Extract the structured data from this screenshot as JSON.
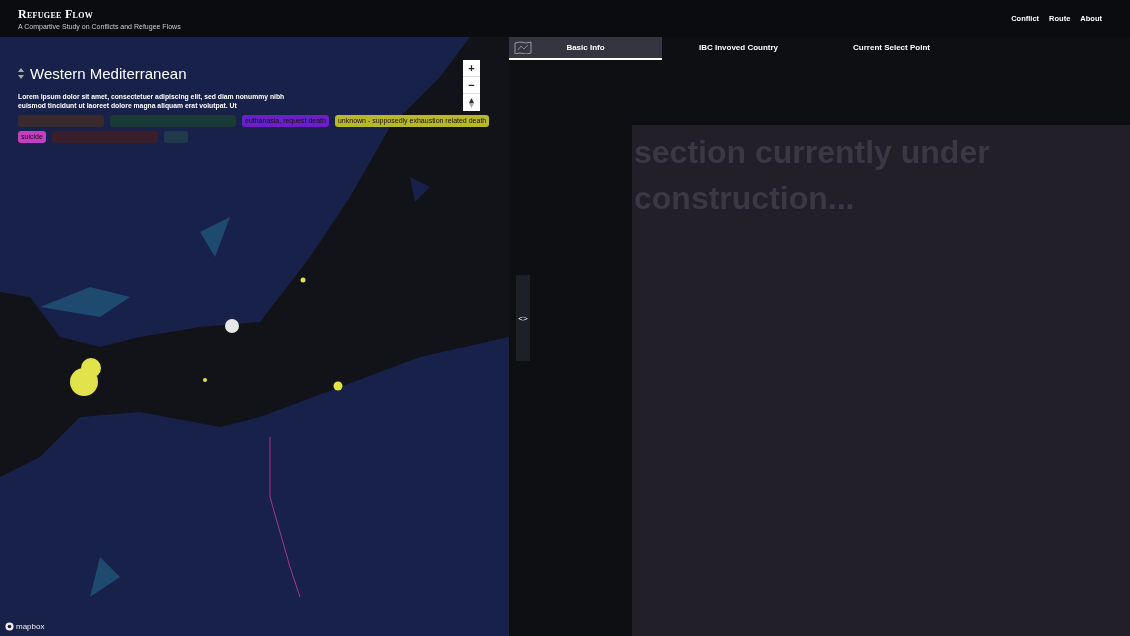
{
  "header": {
    "title": "Refugee Flow",
    "subtitle": "A Compartive Study on Conflicts and Refugee Flows",
    "nav": [
      {
        "label": "Conflict"
      },
      {
        "label": "Route"
      },
      {
        "label": "About"
      }
    ]
  },
  "map": {
    "kind": "picture",
    "region_title": "Western Mediterranean",
    "description": "Lorem ipsum dolor sit amet, consectetuer adipiscing elit, sed diam nonummy nibh euismod tincidunt ut laoreet dolore magna aliquam erat volutpat. Ut",
    "zoom_controls": [
      {
        "kind": "zoom-in",
        "label": "+"
      },
      {
        "kind": "zoom-out",
        "label": "−"
      },
      {
        "kind": "compass"
      }
    ],
    "attribution": "mapbox"
  },
  "legend": [
    {
      "color": "#3a2a2e"
    },
    {
      "color": "#1a3a36"
    },
    {
      "label": "euthanasia, request death",
      "color": "#6a1fc8"
    },
    {
      "label": "unknown - supposedly exhaustion related death",
      "color": "#b8b82a"
    },
    {
      "label": "suicide",
      "color": "#c040c0"
    },
    {
      "color": "#3a1f2a"
    },
    {
      "color": "#1f3a4a"
    }
  ],
  "panel": {
    "tabs": [
      {
        "label": "Basic Info",
        "selected": true
      },
      {
        "label": "IBC Invoved Country",
        "selected": false
      },
      {
        "label": "Current Select Point",
        "selected": false
      }
    ],
    "toggle": "<>",
    "message": "section currently under construction..."
  }
}
